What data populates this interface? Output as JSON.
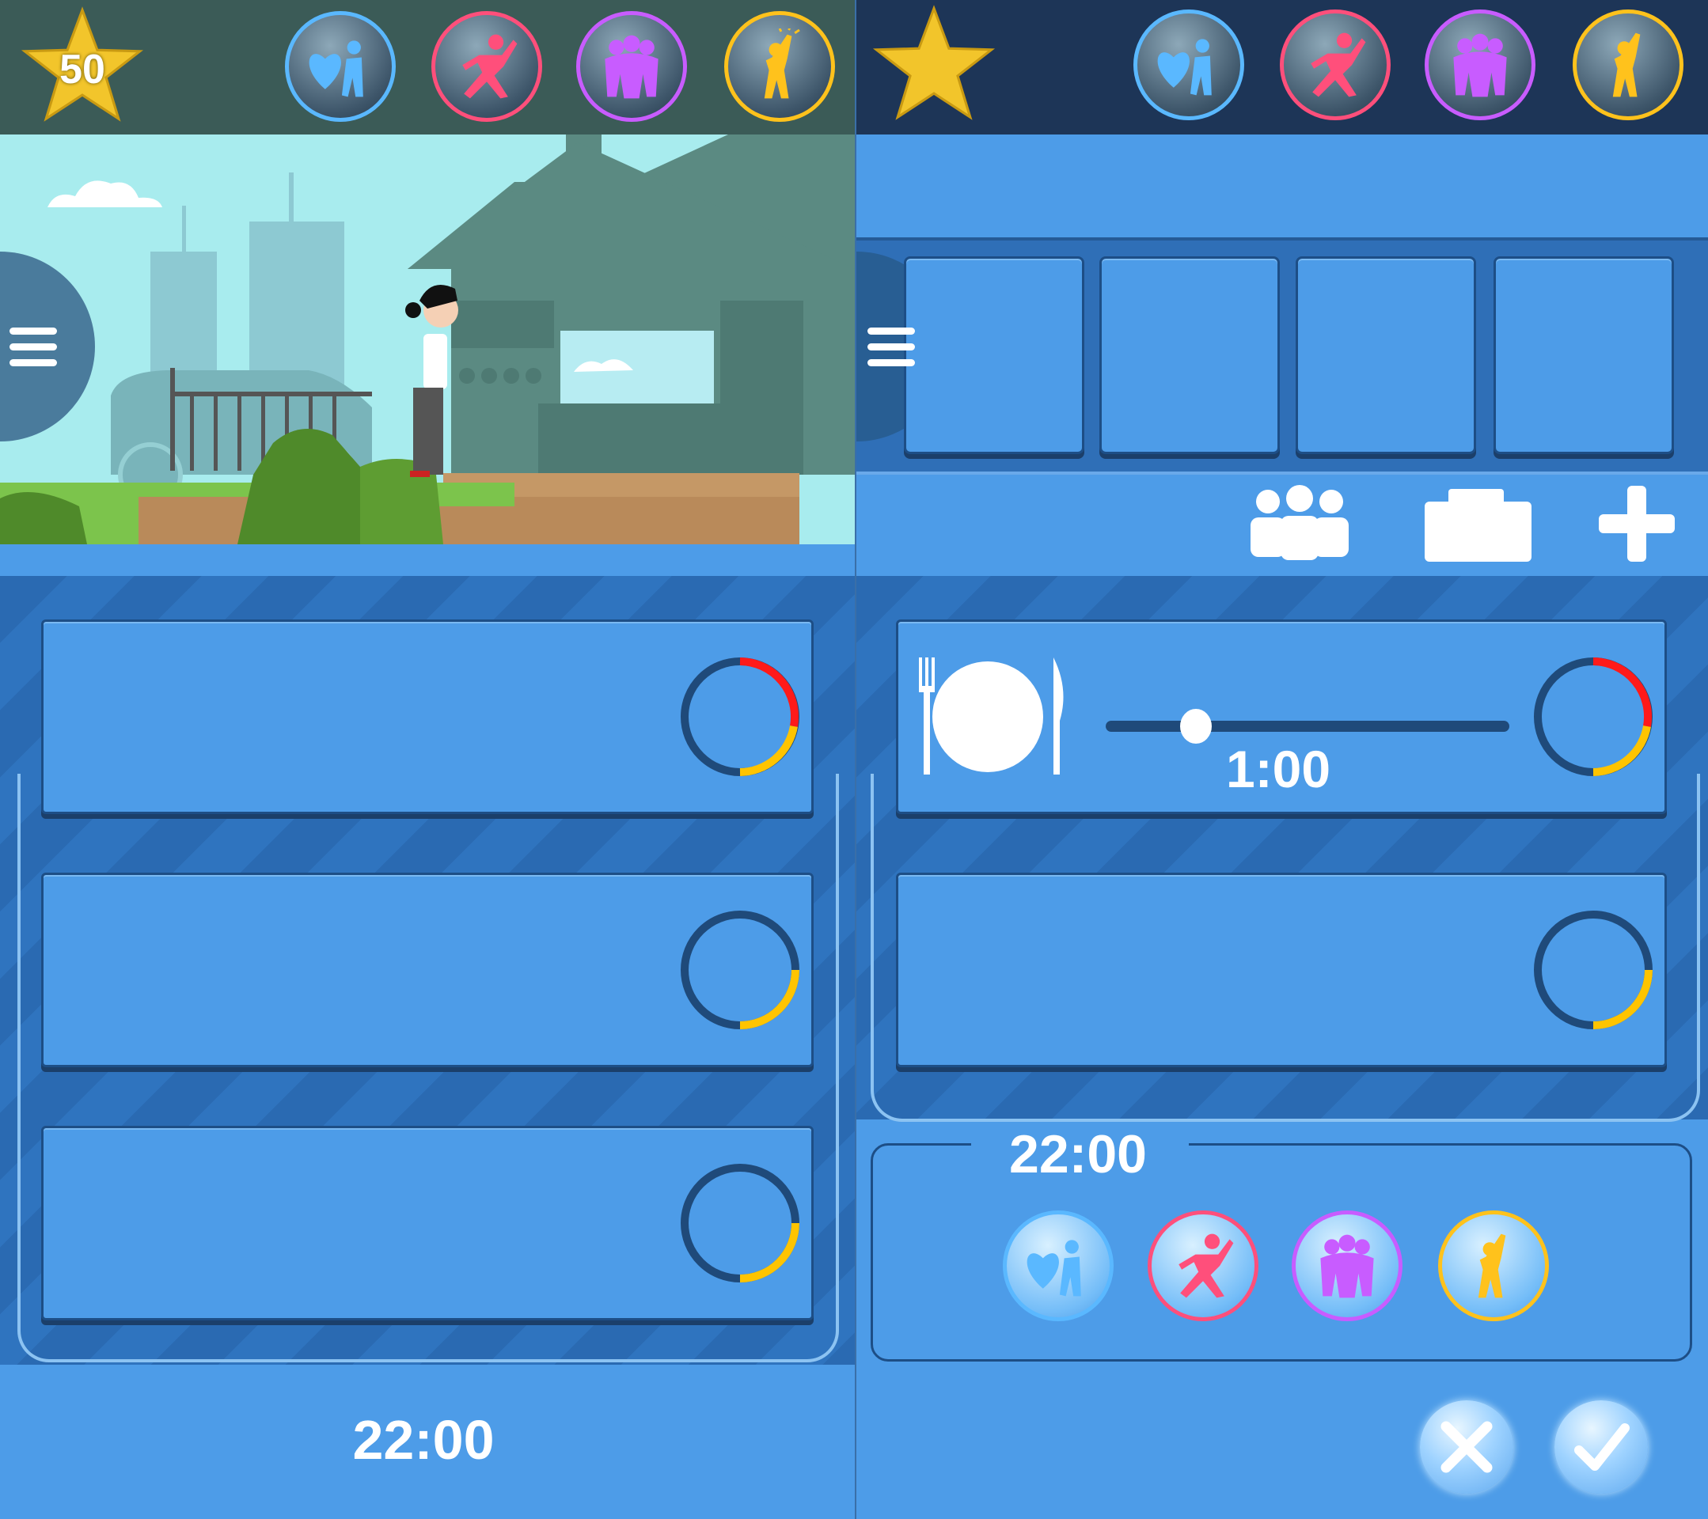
{
  "left_screen": {
    "star_score": "50",
    "menu_icon": "hamburger-icon",
    "task_time": "22:00",
    "categories": [
      {
        "name": "heart-person-icon",
        "color": "#5ab8ff"
      },
      {
        "name": "running-person-icon",
        "color": "#ff4f7b"
      },
      {
        "name": "group-people-icon",
        "color": "#c85cff"
      },
      {
        "name": "cheering-person-icon",
        "color": "#ffc21c"
      }
    ],
    "task_rows": [
      {
        "ring_colors": [
          "#ff1a1a",
          "#ffc400"
        ]
      },
      {
        "ring_colors": [
          "#ffc400"
        ]
      },
      {
        "ring_colors": [
          "#ffc400"
        ]
      }
    ]
  },
  "right_screen": {
    "menu_icon": "hamburger-icon",
    "toolbar_icons": [
      "group-icon",
      "camera-icon",
      "add-icon"
    ],
    "activity": {
      "icon": "fork-plate-knife-icon",
      "duration": "1:00",
      "slider_value": 0.2
    },
    "task_rows": [
      {
        "ring_colors": [
          "#ff1a1a",
          "#ffc400"
        ]
      },
      {
        "ring_colors": [
          "#ffc400"
        ]
      }
    ],
    "schedule_time": "22:00",
    "bottom_categories": [
      "heart-person-icon",
      "running-person-icon",
      "group-people-icon",
      "cheering-person-icon"
    ],
    "cancel_icon": "close-icon",
    "confirm_icon": "check-icon"
  }
}
